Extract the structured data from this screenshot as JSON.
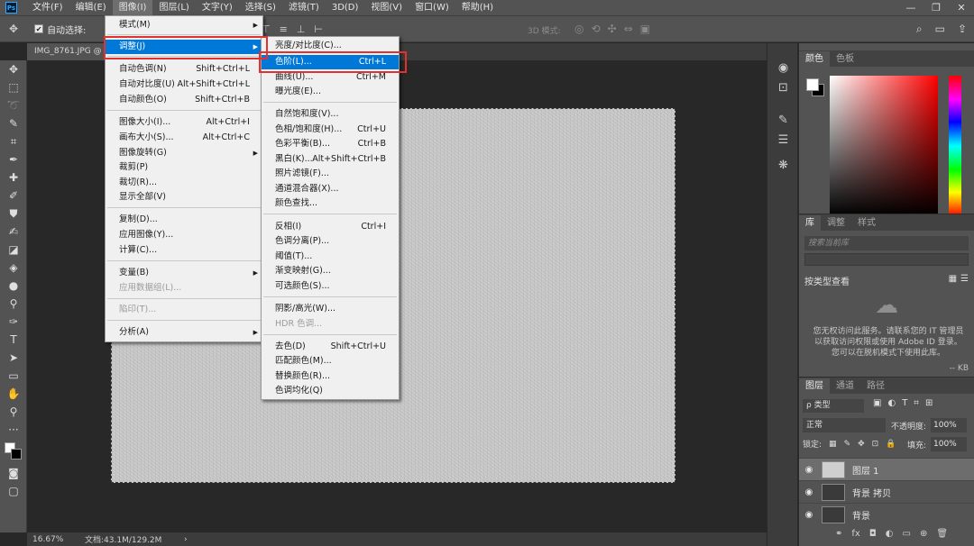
{
  "menubar": {
    "logo": "Ps",
    "items": [
      "文件(F)",
      "编辑(E)",
      "图像(I)",
      "图层(L)",
      "文字(Y)",
      "选择(S)",
      "滤镜(T)",
      "3D(D)",
      "视图(V)",
      "窗口(W)",
      "帮助(H)"
    ],
    "window_controls": [
      "—",
      "❐",
      "✕"
    ]
  },
  "options_bar": {
    "auto_select_label": "自动选择:",
    "mode_3d_label": "3D 模式:"
  },
  "document": {
    "tab_label": "IMG_8761.JPG @"
  },
  "status_bar": {
    "zoom": "16.67%",
    "doc_size": "文档:43.1M/129.2M",
    "arrow": "›"
  },
  "image_menu": {
    "items": [
      {
        "label": "模式(M)",
        "shortcut": "",
        "submenu": true,
        "disabled": false
      },
      {
        "label": "调整(J)",
        "shortcut": "",
        "submenu": true,
        "disabled": false,
        "highlighted": true
      },
      {
        "label": "自动色调(N)",
        "shortcut": "Shift+Ctrl+L",
        "disabled": false
      },
      {
        "label": "自动对比度(U)",
        "shortcut": "Alt+Shift+Ctrl+L",
        "disabled": false
      },
      {
        "label": "自动颜色(O)",
        "shortcut": "Shift+Ctrl+B",
        "disabled": false
      },
      {
        "label": "图像大小(I)...",
        "shortcut": "Alt+Ctrl+I",
        "disabled": false
      },
      {
        "label": "画布大小(S)...",
        "shortcut": "Alt+Ctrl+C",
        "disabled": false
      },
      {
        "label": "图像旋转(G)",
        "shortcut": "",
        "submenu": true,
        "disabled": false
      },
      {
        "label": "裁剪(P)",
        "shortcut": "",
        "disabled": false
      },
      {
        "label": "裁切(R)...",
        "shortcut": "",
        "disabled": false
      },
      {
        "label": "显示全部(V)",
        "shortcut": "",
        "disabled": false
      },
      {
        "label": "复制(D)...",
        "shortcut": "",
        "disabled": false
      },
      {
        "label": "应用图像(Y)...",
        "shortcut": "",
        "disabled": false
      },
      {
        "label": "计算(C)...",
        "shortcut": "",
        "disabled": false
      },
      {
        "label": "变量(B)",
        "shortcut": "",
        "submenu": true,
        "disabled": false
      },
      {
        "label": "应用数据组(L)...",
        "shortcut": "",
        "disabled": true
      },
      {
        "label": "陷印(T)...",
        "shortcut": "",
        "disabled": true
      },
      {
        "label": "分析(A)",
        "shortcut": "",
        "submenu": true,
        "disabled": false
      }
    ]
  },
  "adjust_menu": {
    "items": [
      {
        "label": "亮度/对比度(C)...",
        "shortcut": ""
      },
      {
        "label": "色阶(L)...",
        "shortcut": "Ctrl+L",
        "highlighted": true
      },
      {
        "label": "曲线(U)...",
        "shortcut": "Ctrl+M"
      },
      {
        "label": "曝光度(E)...",
        "shortcut": ""
      },
      {
        "label": "自然饱和度(V)...",
        "shortcut": ""
      },
      {
        "label": "色相/饱和度(H)...",
        "shortcut": "Ctrl+U"
      },
      {
        "label": "色彩平衡(B)...",
        "shortcut": "Ctrl+B"
      },
      {
        "label": "黑白(K)...",
        "shortcut": "Alt+Shift+Ctrl+B"
      },
      {
        "label": "照片滤镜(F)...",
        "shortcut": ""
      },
      {
        "label": "通道混合器(X)...",
        "shortcut": ""
      },
      {
        "label": "颜色查找...",
        "shortcut": ""
      },
      {
        "label": "反相(I)",
        "shortcut": "Ctrl+I"
      },
      {
        "label": "色调分离(P)...",
        "shortcut": ""
      },
      {
        "label": "阈值(T)...",
        "shortcut": ""
      },
      {
        "label": "渐变映射(G)...",
        "shortcut": ""
      },
      {
        "label": "可选颜色(S)...",
        "shortcut": ""
      },
      {
        "label": "阴影/高光(W)...",
        "shortcut": ""
      },
      {
        "label": "HDR 色调...",
        "shortcut": "",
        "disabled": true
      },
      {
        "label": "去色(D)",
        "shortcut": "Shift+Ctrl+U"
      },
      {
        "label": "匹配颜色(M)...",
        "shortcut": ""
      },
      {
        "label": "替换颜色(R)...",
        "shortcut": ""
      },
      {
        "label": "色调均化(Q)",
        "shortcut": ""
      }
    ]
  },
  "color_panel": {
    "tabs": [
      "颜色",
      "色板"
    ],
    "foreground": "#ffffff",
    "background": "#000000"
  },
  "library_panel": {
    "tabs": [
      "库",
      "调整",
      "样式"
    ],
    "search_placeholder": "搜索当前库",
    "group_by": "按类型查看",
    "message": "您无权访问此服务。请联系您的 IT 管理员以获取访问权限或使用 Adobe ID 登录。您可以在脱机模式下使用此库。",
    "footer": "-- KB"
  },
  "layers_panel": {
    "tabs": [
      "图层",
      "通道",
      "路径"
    ],
    "filter_label": "ρ 类型",
    "blend_mode": "正常",
    "opacity_label": "不透明度:",
    "opacity": "100%",
    "lock_label": "锁定:",
    "fill_label": "填充:",
    "fill": "100%",
    "layers": [
      {
        "name": "图层 1",
        "selected": true,
        "thumb_color": "#cfcfcf"
      },
      {
        "name": "背景 拷贝",
        "selected": false,
        "thumb_color": "#3a3a3a"
      },
      {
        "name": "背景",
        "selected": false,
        "thumb_color": "#3a3a3a"
      }
    ]
  }
}
